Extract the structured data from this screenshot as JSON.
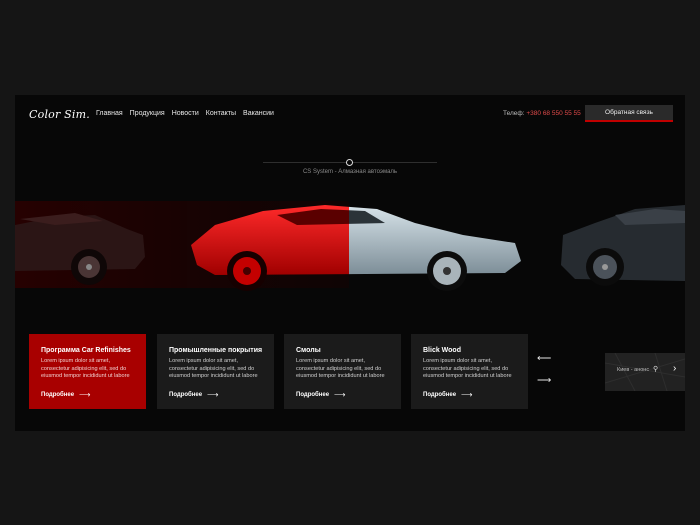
{
  "header": {
    "logo": "Color Sim.",
    "nav": [
      "Главная",
      "Продукция",
      "Новости",
      "Контакты",
      "Вакансии"
    ],
    "phone_label": "Телеф: ",
    "phone_number": "+380 68 550 55 55",
    "cta": "Обратная связь"
  },
  "hero": {
    "caption": "CS System - Алмазная автоэмаль"
  },
  "cards": [
    {
      "title": "Программа Car Refinishes",
      "text": "Lorem ipsum dolor sit amet, consectetur adipisicing elit, sed do eiusmod tempor incididunt ut labore",
      "more": "Подробнее"
    },
    {
      "title": "Промышленные покрытия",
      "text": "Lorem ipsum dolor sit amet, consectetur adipisicing elit, sed do eiusmod tempor incididunt ut labore",
      "more": "Подробнее"
    },
    {
      "title": "Смолы",
      "text": "Lorem ipsum dolor sit amet, consectetur adipisicing elit, sed do eiusmod tempor incididunt ut labore",
      "more": "Подробнее"
    },
    {
      "title": "Blick Wood",
      "text": "Lorem ipsum dolor sit amet, consectetur adipisicing elit, sed do eiusmod tempor incididunt ut labore",
      "more": "Подробнее"
    }
  ],
  "map": {
    "label": "Киев - анонс"
  },
  "colors": {
    "accent": "#c00000",
    "card_active": "#a80000",
    "background": "#070707"
  },
  "icons": {
    "prev": "arrow-left-icon",
    "next": "arrow-right-icon",
    "map_pin": "map-pin-icon"
  }
}
